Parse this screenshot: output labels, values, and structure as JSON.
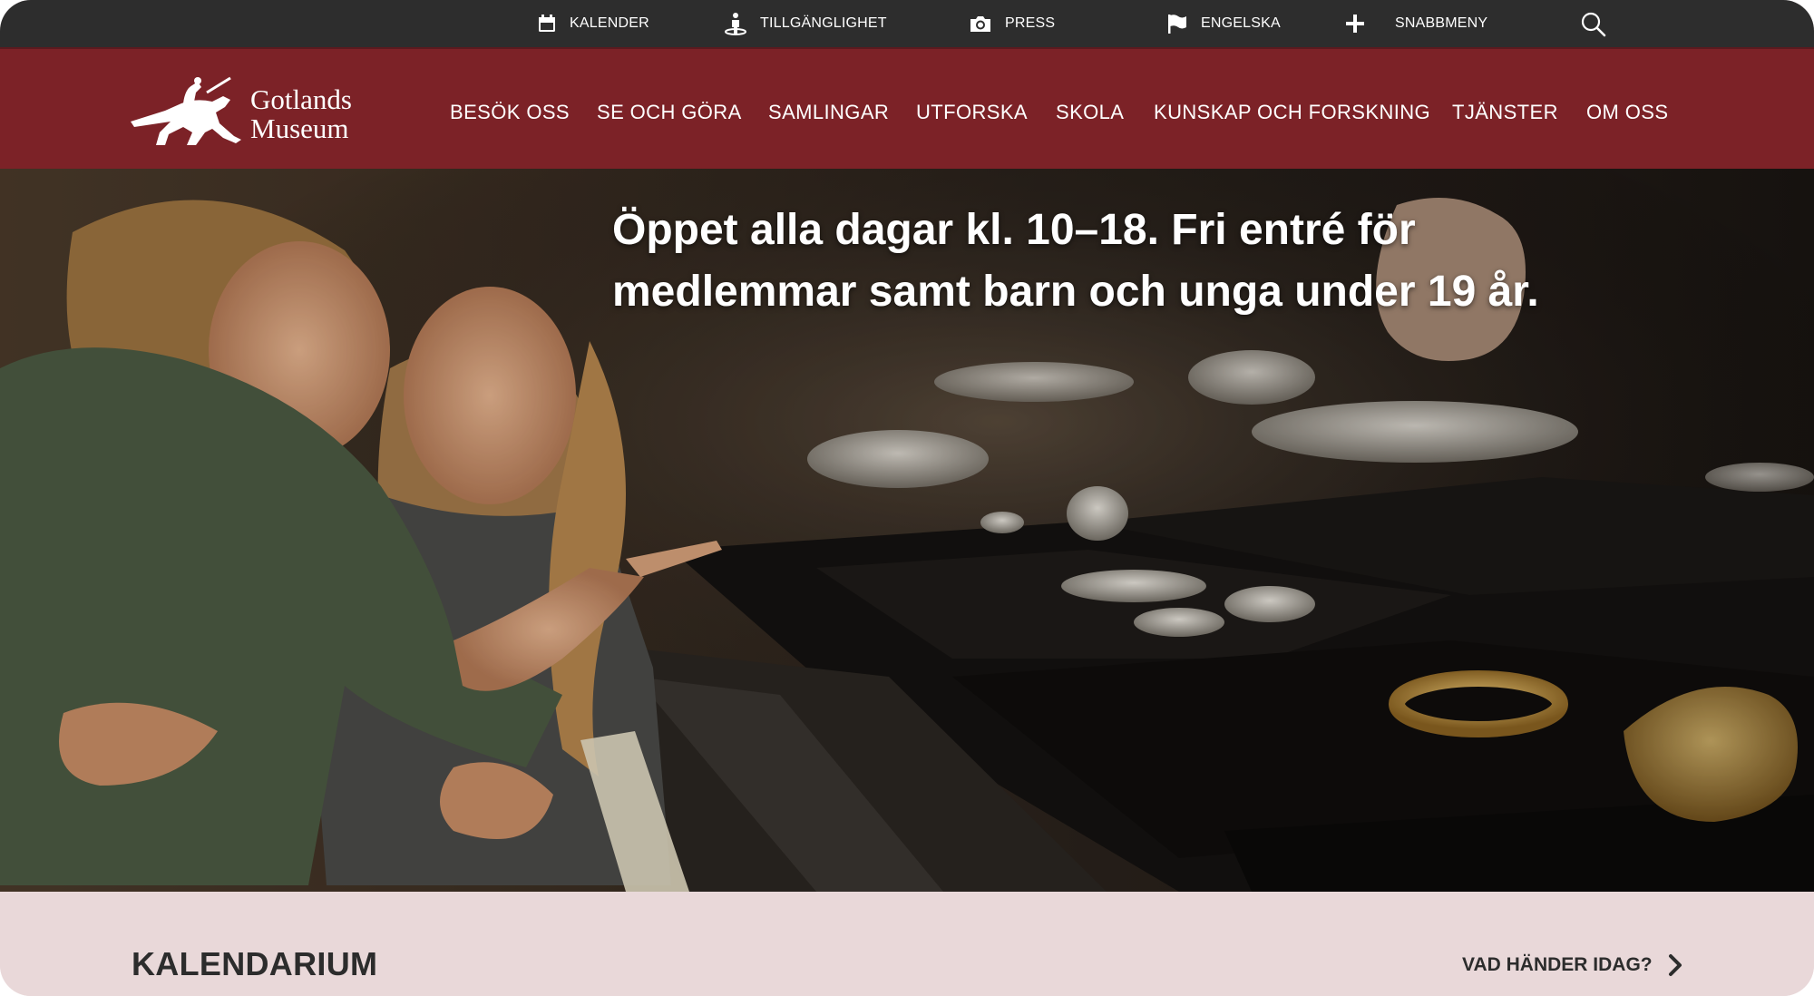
{
  "colors": {
    "utility_bg": "#2d2d2d",
    "brand": "#7c2227",
    "calendar_bg": "#e9d8d9",
    "text_light": "#ffffff",
    "text_dark": "#2c2c2c"
  },
  "utility": {
    "items": [
      {
        "label": "KALENDER",
        "icon": "calendar-icon"
      },
      {
        "label": "TILLGÄNGLIGHET",
        "icon": "accessibility-icon"
      },
      {
        "label": "PRESS",
        "icon": "camera-icon"
      },
      {
        "label": "ENGELSKA",
        "icon": "flag-icon"
      },
      {
        "label": "SNABBMENY",
        "icon": "plus-icon"
      }
    ],
    "search_icon": "search-icon"
  },
  "logo": {
    "line1": "Gotlands",
    "line2": "Museum",
    "icon": "horse-rider-logo"
  },
  "nav": {
    "items": [
      "BESÖK OSS",
      "SE OCH GÖRA",
      "SAMLINGAR",
      "UTFORSKA",
      "SKOLA",
      "KUNSKAP OCH FORSKNING",
      "TJÄNSTER",
      "OM OSS"
    ]
  },
  "hero": {
    "line1": "Öppet alla dagar kl. 10–18. Fri entré för",
    "line2": "medlemmar samt barn och unga under 19 år."
  },
  "calendar": {
    "title": "KALENDARIUM",
    "link": "VAD HÄNDER IDAG?",
    "link_icon": "chevron-right-icon"
  }
}
